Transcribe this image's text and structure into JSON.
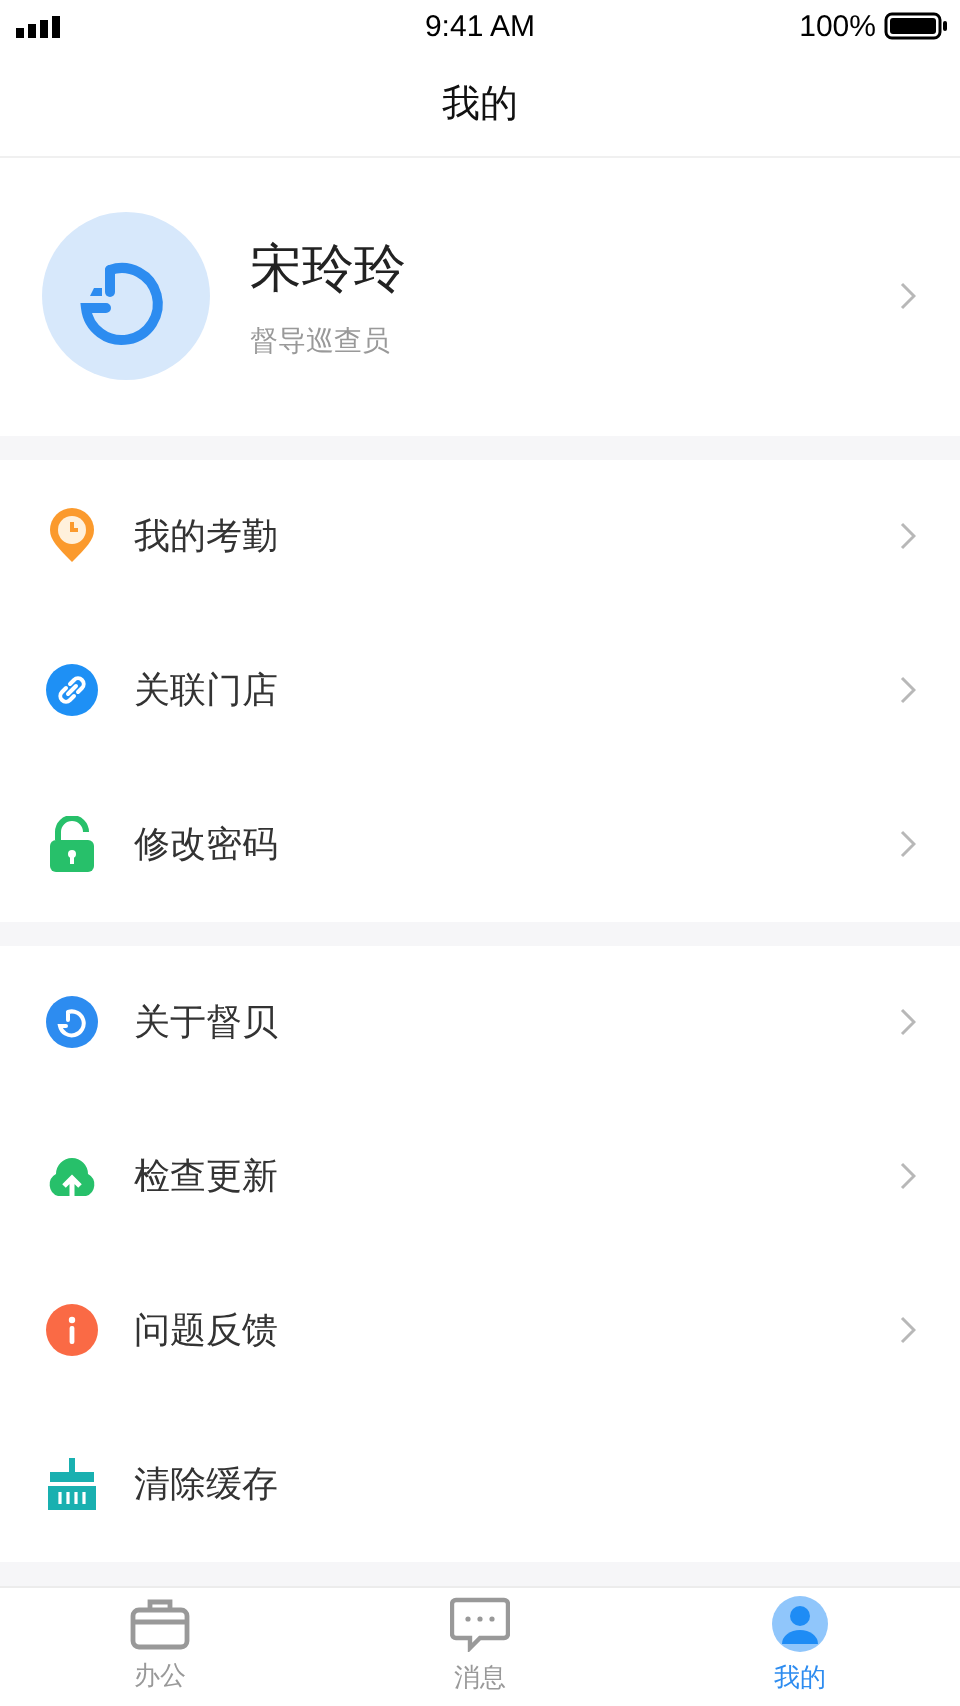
{
  "status_bar": {
    "time": "9:41 AM",
    "battery": "100%"
  },
  "header": {
    "title": "我的"
  },
  "profile": {
    "name": "宋玲玲",
    "role": "督导巡查员"
  },
  "groups": [
    {
      "items": [
        {
          "kind": "attendance",
          "label": "我的考勤",
          "arrow": true
        },
        {
          "kind": "link",
          "label": "关联门店",
          "arrow": true
        },
        {
          "kind": "lock",
          "label": "修改密码",
          "arrow": true
        }
      ]
    },
    {
      "items": [
        {
          "kind": "about",
          "label": "关于督贝",
          "arrow": true
        },
        {
          "kind": "update",
          "label": "检查更新",
          "arrow": true
        },
        {
          "kind": "feedback",
          "label": "问题反馈",
          "arrow": true
        },
        {
          "kind": "clear",
          "label": "清除缓存",
          "arrow": false
        }
      ]
    }
  ],
  "tab_bar": [
    {
      "kind": "office",
      "label": "办公",
      "selected": false
    },
    {
      "kind": "message",
      "label": "消息",
      "selected": false
    },
    {
      "kind": "me",
      "label": "我的",
      "selected": true
    }
  ]
}
